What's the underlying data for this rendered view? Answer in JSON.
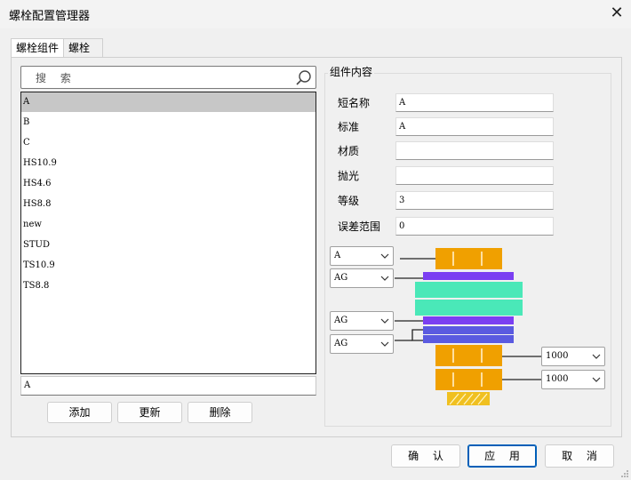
{
  "window": {
    "title": "螺栓配置管理器",
    "close_icon": "close-icon"
  },
  "tabs": [
    {
      "label": "螺栓组件",
      "active": true
    },
    {
      "label": "螺栓",
      "active": false
    }
  ],
  "search": {
    "placeholder": "搜 索",
    "icon": "search-icon"
  },
  "assembly_list": {
    "items": [
      "A",
      "B",
      "C",
      "HS10.9",
      "HS4.6",
      "HS8.8",
      "new",
      "STUD",
      "TS10.9",
      "TS8.8"
    ],
    "selected": "A"
  },
  "name_field": {
    "value": "A"
  },
  "list_buttons": {
    "add": "添加",
    "update": "更新",
    "delete": "删除"
  },
  "content": {
    "group_title": "组件内容",
    "fields": [
      {
        "label": "短名称",
        "value": "A"
      },
      {
        "label": "标准",
        "value": "A"
      },
      {
        "label": "材质",
        "value": ""
      },
      {
        "label": "抛光",
        "value": ""
      },
      {
        "label": "等级",
        "value": "3"
      },
      {
        "label": "误差范围",
        "value": "0"
      }
    ],
    "dropdowns": {
      "bolt": "A",
      "washer_top": "AG",
      "washer_bottom_1": "AG",
      "washer_bottom_2": "AG",
      "nut_1": "1000",
      "nut_2": "1000"
    },
    "colors": {
      "bolt": "#f0a000",
      "washer": "#7b3ff2",
      "part": "#4ae8b8",
      "washer2": "#5a5ae0",
      "thread": "#f0c020"
    }
  },
  "footer": {
    "ok": "确 认",
    "apply": "应 用",
    "cancel": "取 消"
  }
}
